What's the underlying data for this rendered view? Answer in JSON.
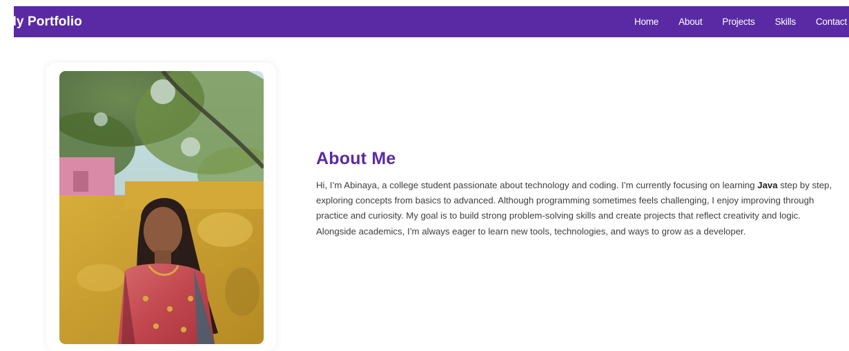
{
  "navbar": {
    "brand": "My Portfolio",
    "links": [
      "Home",
      "About",
      "Projects",
      "Skills",
      "Contact"
    ]
  },
  "about": {
    "title": "About Me",
    "text_before": "Hi, I’m Abinaya, a college student passionate about technology and coding. I’m currently focusing on learning ",
    "text_bold": "Java",
    "text_after": " step by step, exploring concepts from basics to advanced. Although programming sometimes feels challenging, I enjoy improving through practice and curiosity. My goal is to build strong problem-solving skills and create projects that reflect creativity and logic. Alongside academics, I’m always eager to learn new tools, technologies, and ways to grow as a developer."
  },
  "colors": {
    "accent": "#5a2aa4",
    "text": "#3d3d3d",
    "background": "#ffffff"
  }
}
